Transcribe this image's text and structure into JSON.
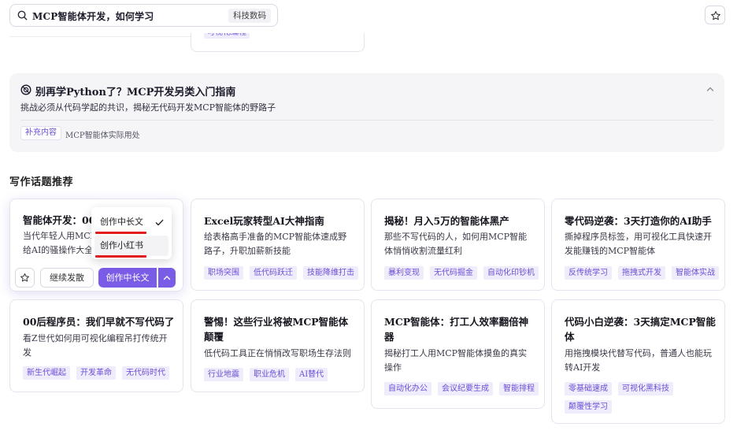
{
  "search": {
    "query": "MCP智能体开发，如何学习",
    "category": "科技数码"
  },
  "top_partial_card": {
    "tag": "可视化编程"
  },
  "guide": {
    "title": "别再学Python了？MCP开发另类入门指南",
    "description": "挑战必须从代码学起的共识，揭秘无代码开发MCP智能体的野路子",
    "badge": "补充内容",
    "note": "MCP智能体实际用处"
  },
  "section_title": "写作话题推荐",
  "active_card": {
    "title": "智能体开发：00",
    "desc_lines": [
      "当代年轻人用MCI",
      "给AI的骚操作大全"
    ]
  },
  "actions": {
    "continue_label": "继续发散",
    "primary_label": "创作中长文"
  },
  "dropdown": {
    "items": [
      "创作中长文",
      "创作小红书"
    ],
    "selected": "创作中长文"
  },
  "cards": [
    {
      "title": "Excel玩家转型AI大神指南",
      "desc": "给表格高手准备的MCP智能体速成野路子，升职加薪新技能",
      "tags": [
        "职场突围",
        "低代码跃迁",
        "技能降维打击"
      ]
    },
    {
      "title": "揭秘！月入5万的智能体黑产",
      "desc": "那些不写代码的人，如何用MCP智能体悄悄收割流量红利",
      "tags": [
        "暴利变现",
        "无代码掘金",
        "自动化印钞机"
      ]
    },
    {
      "title": "零代码逆袭：3天打造你的AI助手",
      "desc": "撕掉程序员标签，用可视化工具快速开发能赚钱的MCP智能体",
      "tags": [
        "反传统学习",
        "拖拽式开发",
        "智能体实战"
      ]
    },
    {
      "title": "00后程序员：我们早就不写代码了",
      "desc": "看Z世代如何用可视化编程吊打传统开发",
      "tags": [
        "新生代崛起",
        "开发革命",
        "无代码时代"
      ]
    },
    {
      "title": "警惕！这些行业将被MCP智能体颠覆",
      "desc": "低代码工具正在悄悄改写职场生存法则",
      "tags": [
        "行业地震",
        "职业危机",
        "AI替代"
      ]
    },
    {
      "title": "MCP智能体：打工人效率翻倍神器",
      "desc": "揭秘打工人用MCP智能体摸鱼的真实操作",
      "tags": [
        "自动化办公",
        "会议纪要生成",
        "智能排程"
      ]
    },
    {
      "title": "代码小白逆袭：3天搞定MCP智能体",
      "desc": "用拖拽模块代替写代码，普通人也能玩转AI开发",
      "tags": [
        "零基础速成",
        "可视化黑科技",
        "颠覆性学习"
      ]
    }
  ],
  "colors": {
    "accent": "#7b5ce6",
    "tag_bg": "#efecfb",
    "tag_text": "#6d4fd6",
    "highlight_underline": "#e01c1c"
  }
}
